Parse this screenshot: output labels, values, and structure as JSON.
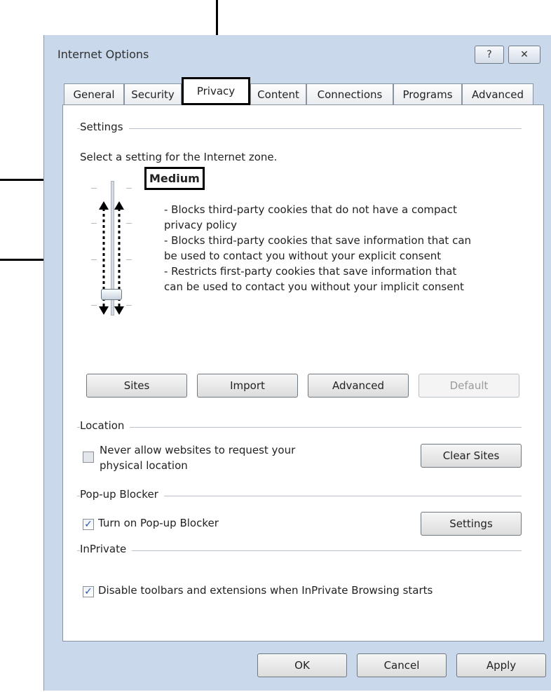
{
  "window": {
    "title": "Internet Options",
    "help_button": "?",
    "close_button": "✕"
  },
  "tabs": [
    {
      "label": "General"
    },
    {
      "label": "Security"
    },
    {
      "label": "Privacy"
    },
    {
      "label": "Content"
    },
    {
      "label": "Connections"
    },
    {
      "label": "Programs"
    },
    {
      "label": "Advanced"
    }
  ],
  "privacy": {
    "settings_group": "Settings",
    "zone_prompt": "Select a setting for the Internet zone.",
    "level_name": "Medium",
    "description": [
      "- Blocks third-party cookies that do not have a compact",
      "privacy policy",
      "- Blocks third-party cookies that save information that can",
      "be used to contact you without your explicit consent",
      "- Restricts first-party cookies that save information that",
      "can be used to contact you without your implicit consent"
    ],
    "buttons": {
      "sites": "Sites",
      "import": "Import",
      "advanced": "Advanced",
      "default": "Default"
    },
    "location_group": "Location",
    "location_checkbox_line1": "Never allow websites to request your",
    "location_checkbox_line2": "physical location",
    "location_checked": false,
    "clear_sites": "Clear Sites",
    "popup_group": "Pop-up Blocker",
    "popup_checkbox": "Turn on Pop-up Blocker",
    "popup_checked": true,
    "popup_settings": "Settings",
    "inprivate_group": "InPrivate",
    "inprivate_checkbox": "Disable toolbars and extensions when InPrivate Browsing starts",
    "inprivate_checked": true
  },
  "footer": {
    "ok": "OK",
    "cancel": "Cancel",
    "apply": "Apply"
  }
}
